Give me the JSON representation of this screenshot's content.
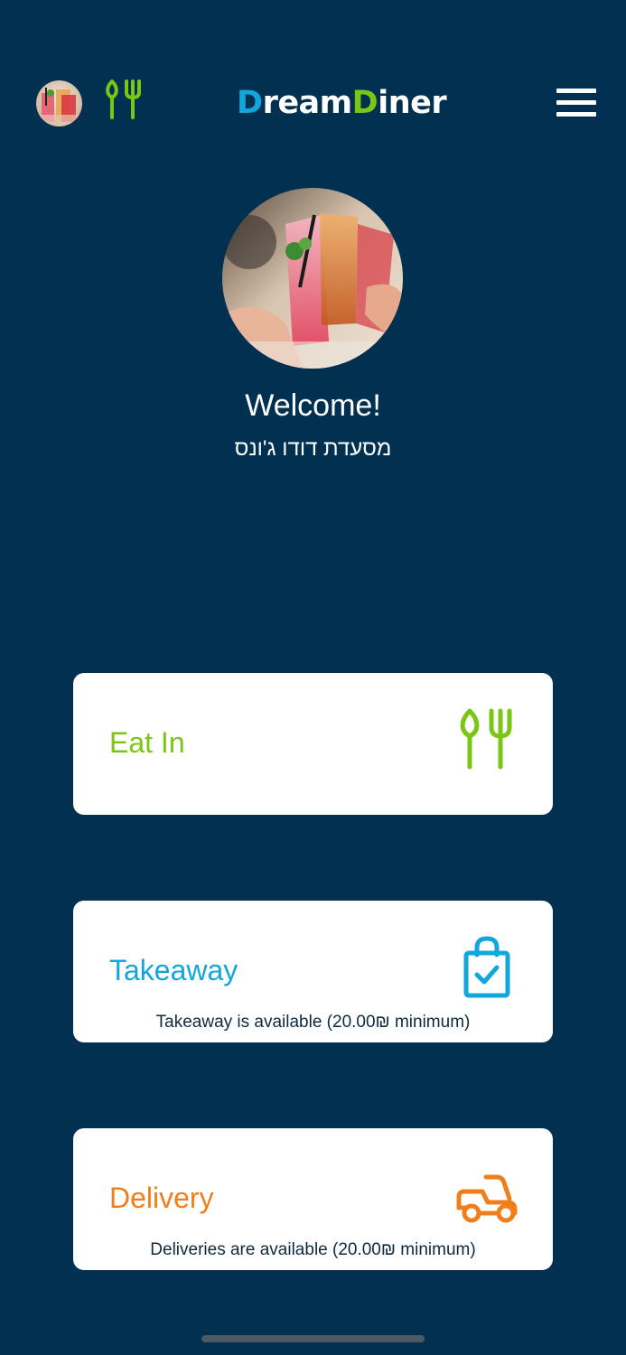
{
  "header": {
    "logo_part1": "D",
    "logo_part2": "ream",
    "logo_part3": "D",
    "logo_part4": "iner",
    "icons": [
      "avatar",
      "utensils-icon",
      "menu-icon"
    ]
  },
  "profile": {
    "welcome": "Welcome!",
    "restaurant_name": "מסעדת דודו ג'ונס"
  },
  "options": {
    "eat_in": {
      "label": "Eat In",
      "icon": "utensils-icon",
      "color": "#7ac614"
    },
    "takeaway": {
      "label": "Takeaway",
      "note": "Takeaway is available (20.00₪ minimum)",
      "icon": "shopping-bag-icon",
      "color": "#11a7dc"
    },
    "delivery": {
      "label": "Delivery",
      "note": "Deliveries are available (20.00₪ minimum)",
      "icon": "scooter-icon",
      "color": "#f07e1a"
    }
  },
  "colors": {
    "background": "#023050",
    "card": "#ffffff",
    "accent_green": "#7ac614",
    "accent_blue": "#11a7dc",
    "accent_orange": "#f07e1a"
  }
}
